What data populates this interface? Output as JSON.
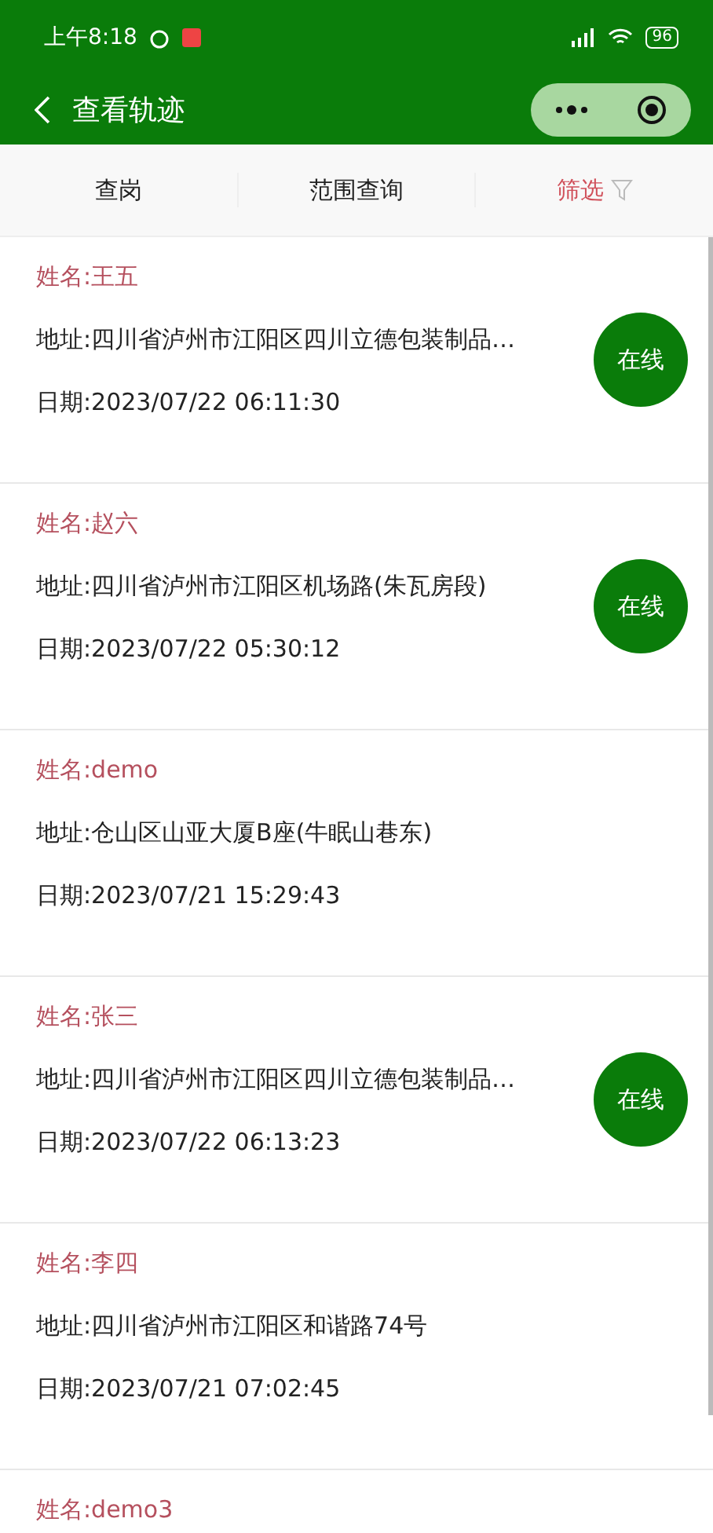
{
  "status_bar": {
    "time": "上午8:18",
    "battery": "96"
  },
  "nav": {
    "title": "查看轨迹"
  },
  "tabs": [
    {
      "label": "查岗",
      "selected": false
    },
    {
      "label": "范围查询",
      "selected": false
    },
    {
      "label": "筛选",
      "selected": true
    }
  ],
  "records": [
    {
      "name": "姓名:王五",
      "address": "地址:四川省泸州市江阳区四川立德包装制品…",
      "date": "日期:2023/07/22 06:11:30",
      "status": "在线"
    },
    {
      "name": "姓名:赵六",
      "address": "地址:四川省泸州市江阳区机场路(朱瓦房段)",
      "date": "日期:2023/07/22 05:30:12",
      "status": "在线"
    },
    {
      "name": "姓名:demo",
      "address": "地址:仓山区山亚大厦B座(牛眠山巷东)",
      "date": "日期:2023/07/21 15:29:43"
    },
    {
      "name": "姓名:张三",
      "address": "地址:四川省泸州市江阳区四川立德包装制品…",
      "date": "日期:2023/07/22 06:13:23",
      "status": "在线"
    },
    {
      "name": "姓名:李四",
      "address": "地址:四川省泸州市江阳区和谐路74号",
      "date": "日期:2023/07/21 07:02:45"
    },
    {
      "name": "姓名:demo3"
    }
  ]
}
